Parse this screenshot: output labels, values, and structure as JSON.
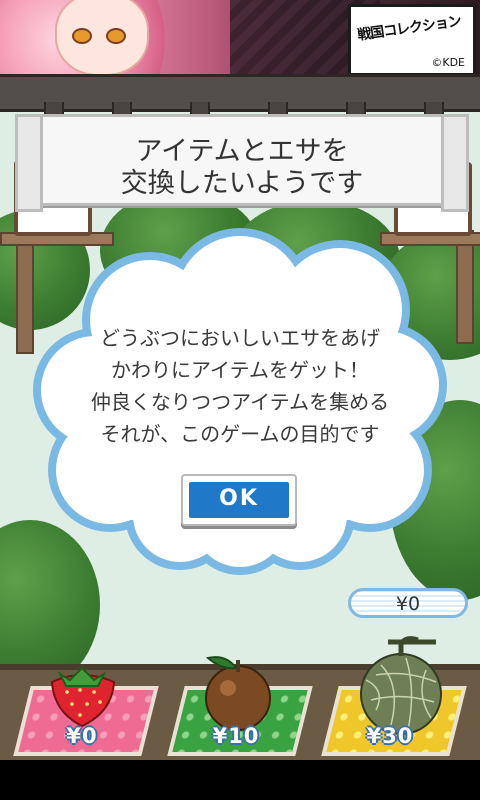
{
  "banner": {
    "logo_text": "戦国コレクション",
    "copyright": "©KDE"
  },
  "title_banner": {
    "line1": "アイテムとエサを",
    "line2": "交換したいようです"
  },
  "dialog": {
    "lines": [
      "どうぶつにおいしいエサをあげ",
      "かわりにアイテムをゲット！",
      "仲良くなりつつアイテムを集める",
      "それが、このゲームの目的です"
    ],
    "ok_label": "OK"
  },
  "money": {
    "label": "¥0"
  },
  "shop": {
    "items": [
      {
        "name": "strawberry",
        "price": "¥0",
        "mat_color": "#ee6c93"
      },
      {
        "name": "orange",
        "price": "¥10",
        "mat_color": "#39a341"
      },
      {
        "name": "melon",
        "price": "¥30",
        "mat_color": "#f0c72b"
      }
    ]
  },
  "colors": {
    "ok_button": "#1f79c8",
    "cloud_border": "#7ab9e3"
  }
}
